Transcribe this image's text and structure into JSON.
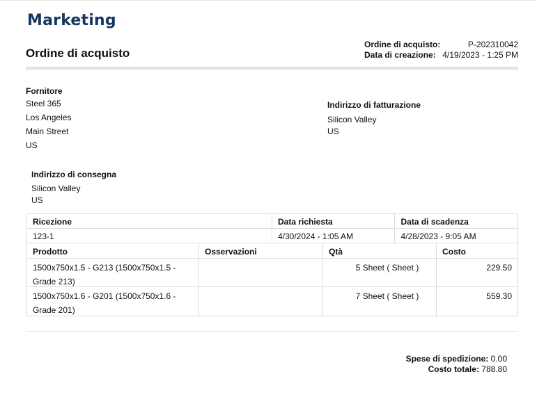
{
  "header": {
    "brand": "Marketing",
    "title": "Ordine di acquisto",
    "po_label": "Ordine di acquisto:",
    "po_number": "P-202310042",
    "created_label": "Data di creazione:",
    "created_value": "4/19/2023 - 1:25 PM"
  },
  "supplier": {
    "label": "Fornitore",
    "lines": [
      "Steel 365",
      "Los Angeles",
      "Main Street",
      "US"
    ]
  },
  "billing": {
    "label": "Indirizzo di fatturazione",
    "lines": [
      "Silicon Valley",
      "US"
    ]
  },
  "shipping": {
    "label": "Indirizzo di consegna",
    "lines": [
      "Silicon Valley",
      "US"
    ]
  },
  "info_table": {
    "headers": [
      "Ricezione",
      "Data richiesta",
      "Data di scadenza"
    ],
    "values": [
      "123-1",
      "4/30/2024 - 1:05 AM",
      "4/28/2023 - 9:05 AM"
    ]
  },
  "items_table": {
    "headers": [
      "Prodotto",
      "Osservazioni",
      "Qtà",
      "Costo"
    ],
    "rows": [
      {
        "product_line1": "1500x750x1.5 - G213 (1500x750x1.5 -",
        "product_line2": "Grade 213)",
        "notes": "",
        "qty": "5 Sheet ( Sheet )",
        "cost": "229.50"
      },
      {
        "product_line1": "1500x750x1.6 - G201 (1500x750x1.6 -",
        "product_line2": "Grade 201)",
        "notes": "",
        "qty": "7 Sheet ( Sheet )",
        "cost": "559.30"
      }
    ]
  },
  "totals": {
    "shipping_label": "Spese di spedizione:",
    "shipping_value": "0.00",
    "total_label": "Costo totale:",
    "total_value": "788.80"
  }
}
